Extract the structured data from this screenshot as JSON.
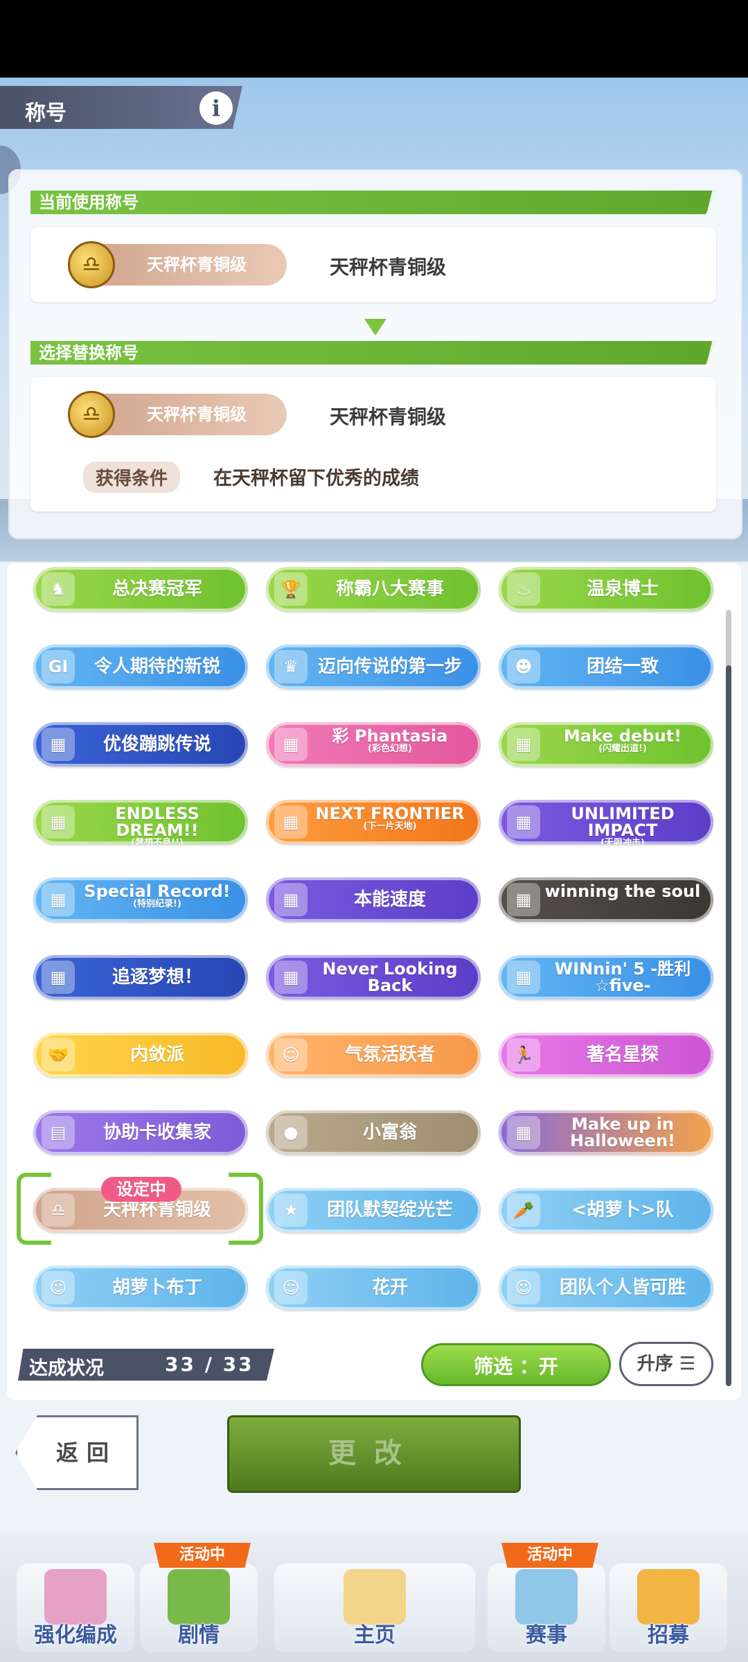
{
  "header": {
    "title": "称号",
    "info_icon": "i"
  },
  "current": {
    "section_label": "当前使用称号",
    "badge_text": "天秤杯青铜级",
    "title_name": "天秤杯青铜级"
  },
  "replace": {
    "section_label": "选择替换称号",
    "badge_text": "天秤杯青铜级",
    "title_name": "天秤杯青铜级",
    "condition_label": "获得条件",
    "condition_text": "在天秤杯留下优秀的成绩"
  },
  "titles": [
    {
      "label": "总决赛冠军",
      "color": "green",
      "icon": "♞"
    },
    {
      "label": "称霸八大赛事",
      "color": "green",
      "icon": "🏆"
    },
    {
      "label": "温泉博士",
      "color": "green",
      "icon": "♨"
    },
    {
      "label": "令人期待的新锐",
      "color": "blue",
      "icon": "GI"
    },
    {
      "label": "迈向传说的第一步",
      "color": "blue",
      "icon": "♛"
    },
    {
      "label": "团结一致",
      "color": "blue",
      "icon": "☻"
    },
    {
      "label": "优俊蹦跳传说",
      "color": "navy",
      "icon": "▦"
    },
    {
      "label": "彩 Phantasia",
      "sub": "(彩色幻想)",
      "color": "pink",
      "icon": "▦"
    },
    {
      "label": "Make debut!",
      "sub": "(闪耀出道!)",
      "color": "green",
      "icon": "▦"
    },
    {
      "label": "ENDLESS DREAM!!",
      "sub": "(梦想不息!!)",
      "color": "green",
      "icon": "▦"
    },
    {
      "label": "NEXT FRONTIER",
      "sub": "(下一片天地)",
      "color": "orange",
      "icon": "▦"
    },
    {
      "label": "UNLIMITED IMPACT",
      "sub": "(无限冲击)",
      "color": "purple",
      "icon": "▦"
    },
    {
      "label": "Special Record!",
      "sub": "(特别纪录!)",
      "color": "blue",
      "icon": "▦"
    },
    {
      "label": "本能速度",
      "color": "purple",
      "icon": "▦"
    },
    {
      "label": "winning the soul",
      "color": "black",
      "icon": "▦"
    },
    {
      "label": "追逐梦想！",
      "color": "navy",
      "icon": "▦"
    },
    {
      "label": "Never Looking Back",
      "color": "purple",
      "icon": "▦"
    },
    {
      "label": "WINnin' 5 -胜利☆five-",
      "color": "blue",
      "icon": "▦"
    },
    {
      "label": "内敛派",
      "color": "yellow",
      "icon": "🤝"
    },
    {
      "label": "气氛活跃者",
      "color": "lorange",
      "icon": "☺"
    },
    {
      "label": "著名星探",
      "color": "magenta",
      "icon": "🏃"
    },
    {
      "label": "协助卡收集家",
      "color": "violet",
      "icon": "▤"
    },
    {
      "label": "小富翁",
      "color": "khaki",
      "icon": "●"
    },
    {
      "label": "Make up in Halloween!",
      "color": "halloween",
      "icon": "▦"
    },
    {
      "label": "天秤杯青铜级",
      "color": "rose",
      "icon": "♎"
    },
    {
      "label": "团队默契绽光芒",
      "color": "sky",
      "icon": "★"
    },
    {
      "label": "<胡萝卜>队",
      "color": "sky",
      "icon": "🥕"
    },
    {
      "label": "胡萝卜布丁",
      "color": "sky",
      "icon": "☺"
    },
    {
      "label": "花开",
      "color": "sky",
      "icon": "☺"
    },
    {
      "label": "团队个人皆可胜",
      "color": "sky",
      "icon": "☺"
    }
  ],
  "selected_tag": "设定中",
  "status": {
    "label": "达成状况",
    "count": "33 / 33"
  },
  "filter_label": "筛选 ：开",
  "sort_label": "升序 ☰",
  "buttons": {
    "back": "返回",
    "change": "更改"
  },
  "nav": [
    {
      "label": "强化编成",
      "badge": ""
    },
    {
      "label": "剧情",
      "badge": "活动中"
    },
    {
      "label": "主页",
      "badge": ""
    },
    {
      "label": "赛事",
      "badge": "活动中"
    },
    {
      "label": "招募",
      "badge": ""
    }
  ]
}
